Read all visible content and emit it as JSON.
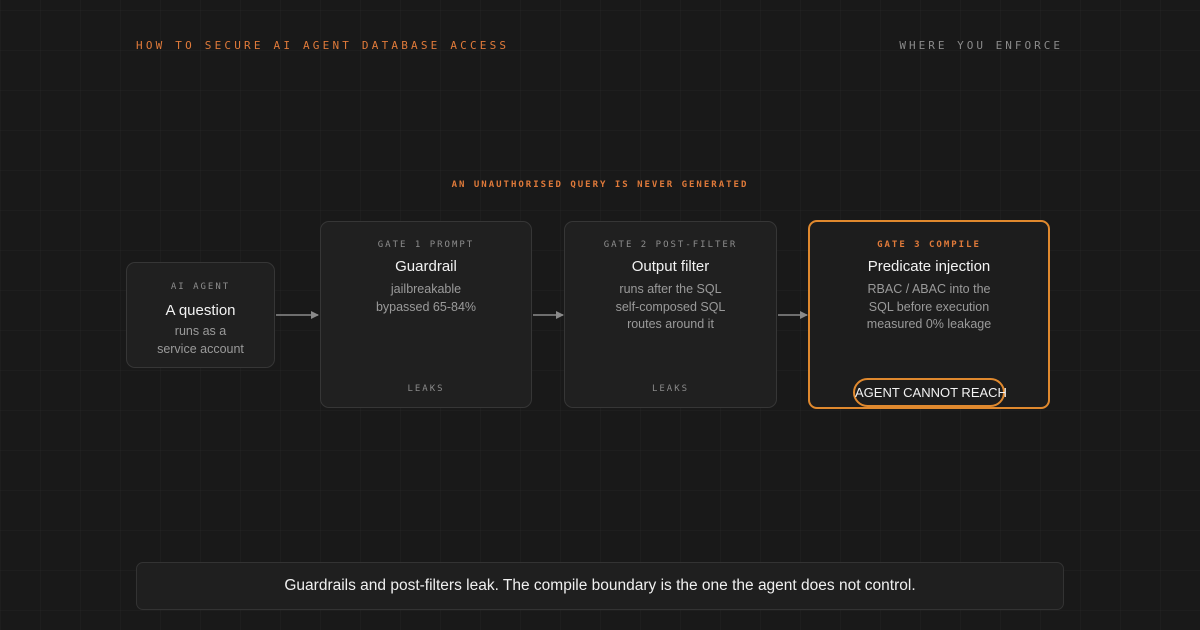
{
  "header": {
    "title": "HOW TO SECURE AI AGENT DATABASE ACCESS",
    "section": "WHERE YOU ENFORCE"
  },
  "flow": {
    "caption": "AN UNAUTHORISED QUERY IS NEVER GENERATED",
    "nodes": [
      {
        "kicker": "AI AGENT",
        "title": "A question",
        "desc_lines": [
          "runs as a",
          "service account"
        ]
      },
      {
        "kicker": "GATE 1 PROMPT",
        "title": "Guardrail",
        "desc_lines": [
          "jailbreakable",
          "bypassed 65-84%"
        ],
        "footer": "LEAKS"
      },
      {
        "kicker": "GATE 2 POST-FILTER",
        "title": "Output filter",
        "desc_lines": [
          "runs after the SQL",
          "self-composed SQL",
          "routes around it"
        ],
        "footer": "LEAKS"
      },
      {
        "kicker": "GATE 3 COMPILE",
        "title": "Predicate injection",
        "desc_lines": [
          "RBAC / ABAC into the",
          "SQL before execution",
          "measured 0% leakage"
        ],
        "badge": "AGENT CANNOT REACH"
      }
    ]
  },
  "summary": "Guardrails and post-filters leak. The compile boundary is the one the agent does not control.",
  "colors": {
    "accent": "#e07a3a",
    "background": "#191919",
    "arrow": "#8a8a8a"
  }
}
